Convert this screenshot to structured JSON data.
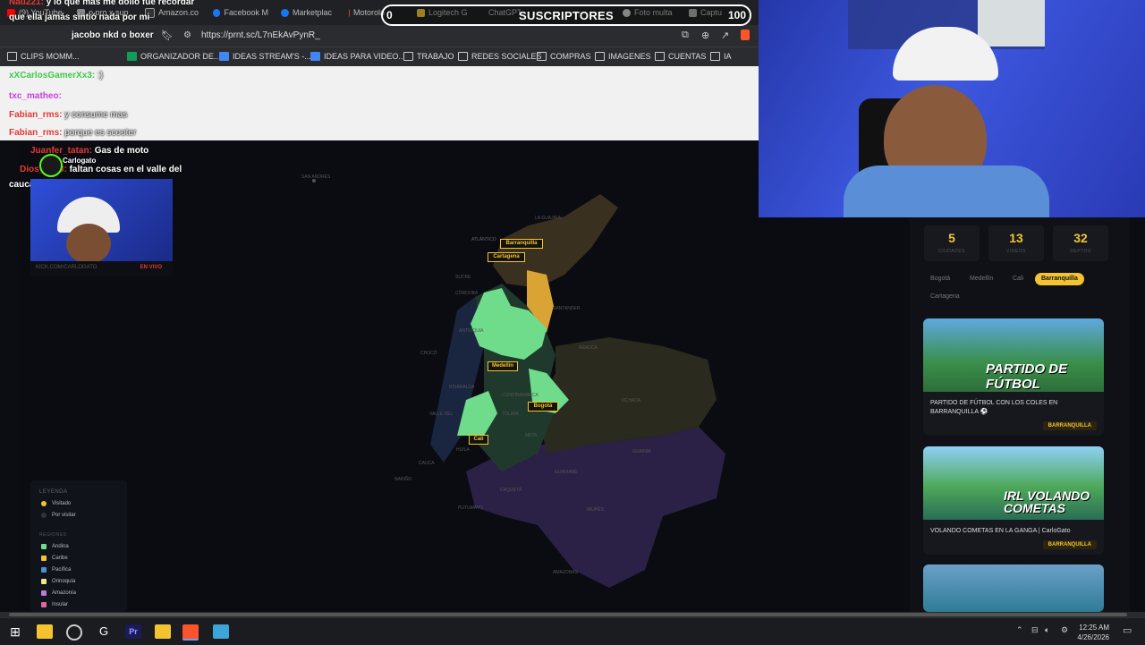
{
  "browser": {
    "tabs": [
      {
        "label": "(9) YouTube",
        "color": "#ff0000"
      },
      {
        "label": "o pro x sup",
        "color": "#888888"
      },
      {
        "label": "Amazon.co",
        "color": "#333333"
      },
      {
        "label": "Facebook M",
        "color": "#1877f2"
      },
      {
        "label": "Marketplac",
        "color": "#1877f2"
      },
      {
        "label": "Motorola",
        "color": "#e53935"
      },
      {
        "label": "Logitech G",
        "color": "#f4c430"
      },
      {
        "label": "ChatGPT",
        "color": "#aaaaaa"
      },
      {
        "label": "Foto multa",
        "color": "#cccccc"
      },
      {
        "label": "Captu",
        "color": "#aaaaaa"
      }
    ],
    "url": "https://prnt.sc/L7nEkAvPynR_",
    "bookmarks": [
      "CLIPS MOMM...",
      "ORGANIZADOR DE...",
      "IDEAS STREAM'S -...",
      "IDEAS PARA VIDEO...",
      "TRABAJO",
      "REDES SOCIALES",
      "COMPRAS",
      "IMAGENES",
      "CUENTAS",
      "IA"
    ]
  },
  "subscribers": {
    "label": "SUSCRIPTORES",
    "min": "0",
    "max": "100"
  },
  "chat": [
    {
      "user": "Nau221:",
      "text": "y lo que más me dolió fue recordar"
    },
    {
      "user": "",
      "text": "que ella jamás sintió nada por mi"
    },
    {
      "user": "",
      "text": "jacobo nkd o boxer"
    },
    {
      "user": "xXCarlosGamerXx3:",
      "text": ":)"
    },
    {
      "user": "txc_matheo:",
      "text": ""
    },
    {
      "user": "Fabian_rms:",
      "text": "y consume mas"
    },
    {
      "user": "Fabian_rms:",
      "text": "porque es scooter"
    },
    {
      "user": "Juanfer_tatan:",
      "text": "Gas de moto"
    },
    {
      "user": "Dios_0108:",
      "text": "faltan cosas en el valle del"
    },
    {
      "user": "",
      "text": "cauca"
    }
  ],
  "overlay": {
    "name": "Carlogato",
    "site": "KICK.COM/CARLOGATO",
    "live": "EN VIVO"
  },
  "map": {
    "cities": [
      "Barranquilla",
      "Cartagena",
      "Medellín",
      "Bogotá",
      "Cali"
    ],
    "regions_labels": [
      "SAN ANDRÉS",
      "LA GUAJIRA",
      "ATLÁNTICO",
      "SUCRE",
      "CÓRDOBA",
      "SANTANDER",
      "ANTIOQUIA",
      "CHOCÓ",
      "ARAUCA",
      "RISARALDA",
      "CUNDINAMARCA",
      "VICHADA",
      "VALLE DEL",
      "TOLIMA",
      "META",
      "HUILA",
      "GUAINÍA",
      "CAUCA",
      "NARIÑO",
      "GUAVIARE",
      "CAQUETÁ",
      "PUTUMAYO",
      "VAUPÉS",
      "AMAZONAS"
    ]
  },
  "legend": {
    "title": "LEYENDA",
    "visited": "Visitado",
    "to_visit": "Por visitar",
    "regions_title": "REGIONES",
    "regions": [
      {
        "name": "Andina",
        "color": "#6fdc8c"
      },
      {
        "name": "Caribe",
        "color": "#f4c430"
      },
      {
        "name": "Pacífica",
        "color": "#4a90d9"
      },
      {
        "name": "Orinoquía",
        "color": "#f0e68c"
      },
      {
        "name": "Amazonía",
        "color": "#b57edc"
      },
      {
        "name": "Insular",
        "color": "#e066a0"
      }
    ]
  },
  "panel": {
    "stats": [
      {
        "value": "5",
        "label": "CIUDADES"
      },
      {
        "value": "13",
        "label": "VIDEOS"
      },
      {
        "value": "32",
        "label": "DEPTOS"
      }
    ],
    "chips": [
      "Bogotá",
      "Medellín",
      "Cali",
      "Barranquilla",
      "Cartagena"
    ],
    "active_chip": "Barranquilla",
    "cards": [
      {
        "thumb_text": "PARTIDO DE FÚTBOL",
        "title": "PARTIDO DE FÚTBOL CON LOS COLES EN BARRANQUILLA ⚽",
        "badge": "BARRANQUILLA"
      },
      {
        "thumb_text": "IRL VOLANDO COMETAS",
        "title": "VOLANDO COMETAS EN LA GANGA | CarloGato",
        "badge": "BARRANQUILLA"
      }
    ]
  },
  "taskbar": {
    "time": "12:25 AM",
    "date": "4/26/2026"
  }
}
